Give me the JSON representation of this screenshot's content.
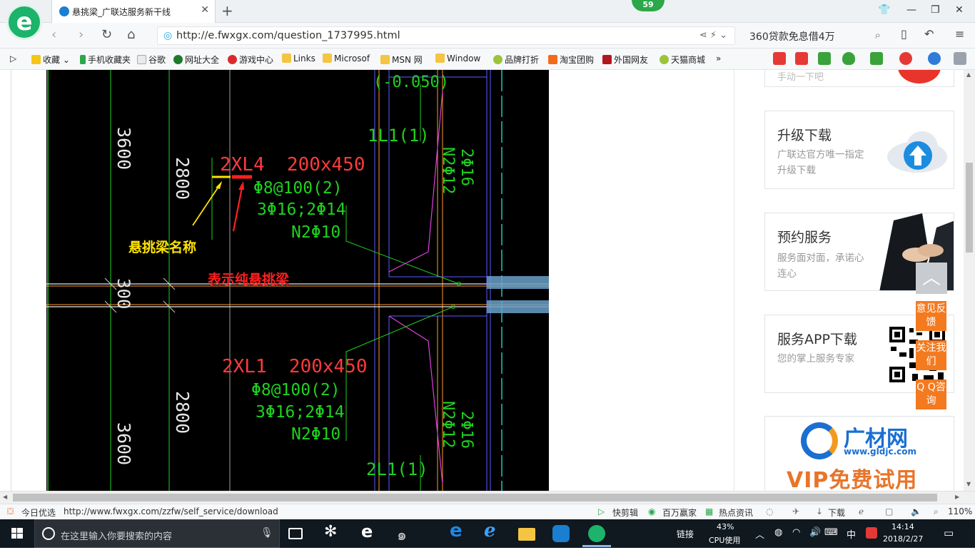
{
  "browser": {
    "tab_title": "悬挑梁_广联达服务新干线",
    "tab_badge": "59",
    "url": "http://e.fwxgx.com/question_1737995.html",
    "search_text": "360贷款免息借4万",
    "bookmarks": [
      "收藏",
      "手机收藏夹",
      "谷歌",
      "网址大全",
      "游戏中心",
      "Links",
      "Microsof",
      "MSN 网",
      "Window",
      "品牌打折",
      "淘宝团购",
      "外国网友",
      "天猫商城"
    ],
    "more": "»"
  },
  "drawing": {
    "label_2800_top": "2800",
    "label_3600_top": "3600",
    "beam1_name": "2XL4  200x450",
    "beam1_stirrup": "Φ8@100(2)",
    "beam1_main": "3Φ16;2Φ14",
    "beam1_side": "N2Φ10",
    "anno_name": "悬挑梁名称",
    "anno_pure": "表示纯悬挑梁",
    "label_300": "300",
    "beam2_name": "2XL1  200x450",
    "beam2_stirrup": "Φ8@100(2)",
    "beam2_main": "3Φ16;2Φ14",
    "beam2_side": "N2Φ10",
    "label_2800_bottom": "2800",
    "label_3600_bottom": "3600",
    "l1_top": "1L1(1)",
    "l1_bottom": "2L1(1)",
    "vert_top_a": "2Φ16",
    "vert_top_b": "N2Φ12",
    "vert_bot_a": "2Φ16",
    "vert_bot_b": "N2Φ12",
    "top_fragment": "(-0.050)"
  },
  "sidebar": {
    "top_card_fragment": "手动一下吧",
    "upgrade": {
      "title": "升级下载",
      "sub": "广联达官方唯一指定升级下载"
    },
    "booking": {
      "title": "预约服务",
      "sub": "服务面对面，承诺心连心"
    },
    "app": {
      "title": "服务APP下载",
      "sub": "您的掌上服务专家"
    },
    "ad": {
      "brand": "广材网",
      "domain": "www.gldjc.com",
      "promo": "VIP免费试用"
    },
    "float_feedback": "意见反馈",
    "float_follow": "关注我们",
    "float_qq": "Q Q咨询",
    "back_top": "︿"
  },
  "status": {
    "today": "今日优选",
    "hover_url": "http://www.fwxgx.com/zzfw/self_service/download",
    "kuaijianji": "快剪辑",
    "baiwan": "百万赢家",
    "redian": "热点资讯",
    "download": "下载",
    "zoom": "110%"
  },
  "taskbar": {
    "search_placeholder": "在这里输入你要搜索的内容",
    "link": "链接",
    "cpu_percent": "43%",
    "cpu_label": "CPU使用",
    "ime": "中",
    "time": "14:14",
    "date": "2018/2/27"
  }
}
